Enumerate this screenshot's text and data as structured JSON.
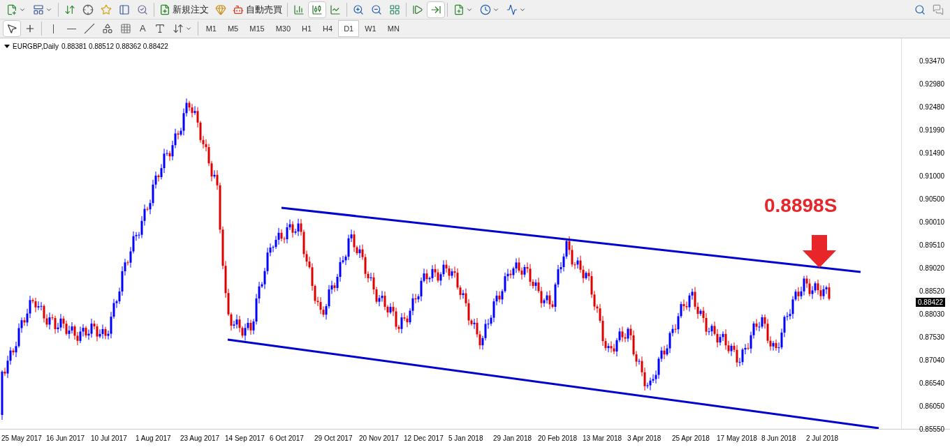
{
  "toolbar": {
    "order_button": "新規注文",
    "autotrade_button": "自動売買",
    "chart_types": [
      {
        "kind": "bar",
        "selected": false
      },
      {
        "kind": "candle",
        "selected": true
      },
      {
        "kind": "line",
        "selected": false
      }
    ],
    "autoscroll": false,
    "chart_shift": true
  },
  "drawing_tools": {
    "tools": [
      {
        "kind": "cursor",
        "selected": true
      },
      {
        "kind": "crosshair",
        "selected": false
      }
    ],
    "text_tool": "A"
  },
  "timeframes": [
    {
      "label": "M1",
      "selected": false
    },
    {
      "label": "M5",
      "selected": false
    },
    {
      "label": "M15",
      "selected": false
    },
    {
      "label": "M30",
      "selected": false
    },
    {
      "label": "H1",
      "selected": false
    },
    {
      "label": "H4",
      "selected": false
    },
    {
      "label": "D1",
      "selected": true
    },
    {
      "label": "W1",
      "selected": false
    },
    {
      "label": "MN",
      "selected": false
    }
  ],
  "chart": {
    "title": "EURGBP,Daily",
    "ohlc": "0.88381 0.88512 0.88362 0.88422",
    "price_axis": [
      "0.93470",
      "0.92980",
      "0.92480",
      "0.91990",
      "0.91490",
      "0.91000",
      "0.90500",
      "0.90010",
      "0.89510",
      "0.89020",
      "0.88520",
      "0.88030",
      "0.87530",
      "0.87040",
      "0.86540",
      "0.86050",
      "0.85550"
    ],
    "current_price": "0.88422",
    "date_axis": [
      "25 May 2017",
      "16 Jun 2017",
      "10 Jul 2017",
      "1 Aug 2017",
      "23 Aug 2017",
      "14 Sep 2017",
      "6 Oct 2017",
      "29 Oct 2017",
      "20 Nov 2017",
      "12 Dec 2017",
      "5 Jan 2018",
      "29 Jan 2018",
      "20 Feb 2018",
      "13 Mar 2018",
      "3 Apr 2018",
      "25 Apr 2018",
      "17 May 2018",
      "8 Jun 2018",
      "2 Jul 2018"
    ],
    "annotation": "0.8898S"
  }
}
